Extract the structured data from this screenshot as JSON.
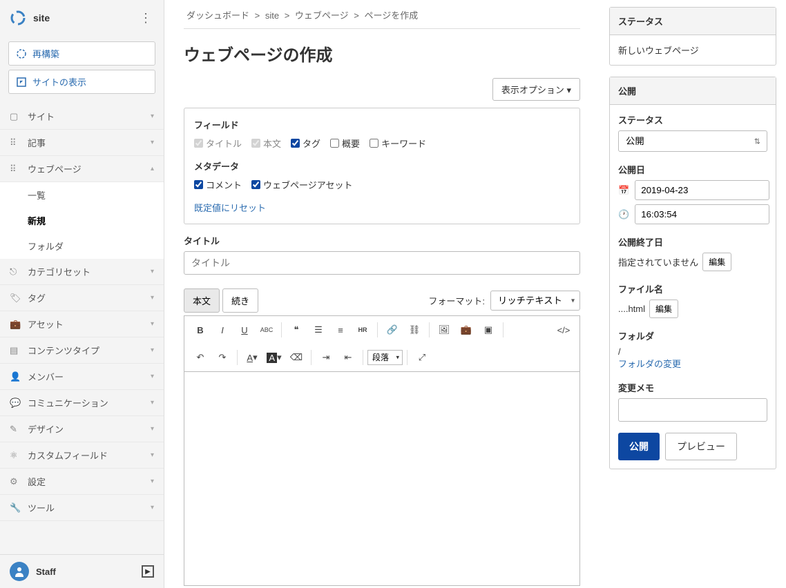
{
  "site_name": "site",
  "sidebar_actions": {
    "rebuild": "再構築",
    "view_site": "サイトの表示"
  },
  "nav": {
    "site": "サイト",
    "entries": "記事",
    "webpages": "ウェブページ",
    "list": "一覧",
    "new": "新規",
    "folder": "フォルダ",
    "category_set": "カテゴリセット",
    "tags": "タグ",
    "assets": "アセット",
    "content_types": "コンテンツタイプ",
    "members": "メンバー",
    "communication": "コミュニケーション",
    "design": "デザイン",
    "custom_fields": "カスタムフィールド",
    "settings": "設定",
    "tools": "ツール"
  },
  "user": "Staff",
  "breadcrumb": {
    "dashboard": "ダッシュボード",
    "site": "site",
    "webpages": "ウェブページ",
    "create": "ページを作成"
  },
  "page_title": "ウェブページの作成",
  "display_options_btn": "表示オプション",
  "fields_heading": "フィールド",
  "fields": {
    "title": "タイトル",
    "body": "本文",
    "tags": "タグ",
    "excerpt": "概要",
    "keywords": "キーワード"
  },
  "metadata_heading": "メタデータ",
  "meta": {
    "comments": "コメント",
    "page_assets": "ウェブページアセット"
  },
  "reset_defaults": "既定値にリセット",
  "title_label": "タイトル",
  "title_placeholder": "タイトル",
  "tabs": {
    "body": "本文",
    "more": "続き"
  },
  "format_label": "フォーマット:",
  "format_value": "リッチテキスト",
  "paragraph_label": "段落",
  "status_panel": {
    "header": "ステータス",
    "value": "新しいウェブページ"
  },
  "publish_panel": {
    "header": "公開",
    "status_label": "ステータス",
    "status_value": "公開",
    "date_label": "公開日",
    "date_value": "2019-04-23",
    "time_value": "16:03:54",
    "end_label": "公開終了日",
    "end_value": "指定されていません",
    "edit": "編集",
    "filename_label": "ファイル名",
    "filename_value": "....html",
    "folder_label": "フォルダ",
    "folder_value": "/",
    "folder_change": "フォルダの変更",
    "memo_label": "変更メモ",
    "publish_btn": "公開",
    "preview_btn": "プレビュー"
  }
}
